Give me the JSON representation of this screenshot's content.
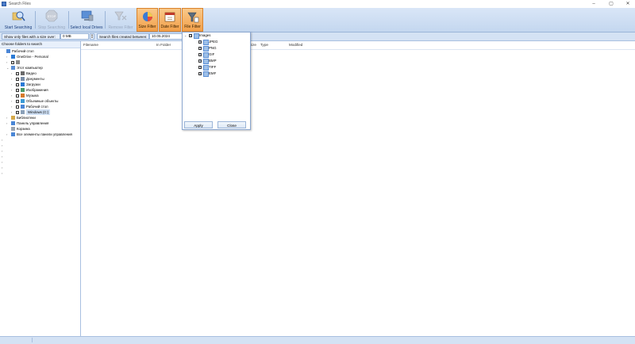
{
  "window": {
    "title": "Search Files",
    "controls": {
      "minimize": "–",
      "maximize": "▢",
      "close": "✕"
    }
  },
  "toolbar": {
    "buttons": [
      {
        "label": "Start Searching",
        "icon": "search-start-icon",
        "state": "enabled"
      },
      {
        "label": "Stop Searching",
        "icon": "stop-icon",
        "state": "disabled"
      },
      {
        "label": "Select local Drives",
        "icon": "drives-icon",
        "state": "enabled"
      },
      {
        "label": "Remove Filter",
        "icon": "remove-filter-icon",
        "state": "disabled"
      },
      {
        "label": "Size Filter",
        "icon": "size-filter-icon",
        "state": "active"
      },
      {
        "label": "Date Filter",
        "icon": "date-filter-icon",
        "state": "active"
      },
      {
        "label": "File Filter",
        "icon": "file-filter-icon",
        "state": "active"
      }
    ]
  },
  "filterbar": {
    "size_label": "Show only files with a size over:",
    "size_value": "0 MB",
    "date_label": "Search files created between:",
    "date_value": "10.05.2024"
  },
  "leftpane": {
    "header": "Choose folders to search",
    "tree": [
      {
        "label": "Рабочий стол",
        "level": 0,
        "icon": "desktop-icon",
        "expander": "",
        "checkbox": false
      },
      {
        "label": "OneDrive - Personal",
        "level": 1,
        "icon": "cloud-icon",
        "expander": "›",
        "checkbox": false
      },
      {
        "label": "",
        "level": 1,
        "icon": "user-icon",
        "expander": "›",
        "checkbox": true
      },
      {
        "label": "Этот компьютер",
        "level": 1,
        "icon": "computer-icon",
        "expander": "⌄",
        "checkbox": false
      },
      {
        "label": "Видео",
        "level": 2,
        "icon": "video-folder-icon",
        "expander": "›",
        "checkbox": true
      },
      {
        "label": "Документы",
        "level": 2,
        "icon": "documents-folder-icon",
        "expander": "›",
        "checkbox": true
      },
      {
        "label": "Загрузки",
        "level": 2,
        "icon": "downloads-folder-icon",
        "expander": "›",
        "checkbox": true
      },
      {
        "label": "Изображения",
        "level": 2,
        "icon": "pictures-folder-icon",
        "expander": "›",
        "checkbox": true
      },
      {
        "label": "Музыка",
        "level": 2,
        "icon": "music-folder-icon",
        "expander": "›",
        "checkbox": true
      },
      {
        "label": "Объемные объекты",
        "level": 2,
        "icon": "3d-objects-folder-icon",
        "expander": "›",
        "checkbox": true
      },
      {
        "label": "Рабочий стол",
        "level": 2,
        "icon": "desktop-folder-icon",
        "expander": "›",
        "checkbox": true
      },
      {
        "label": "Windows (C:)",
        "level": 2,
        "icon": "drive-icon",
        "expander": "›",
        "checkbox": true
      },
      {
        "label": "Библиотеки",
        "level": 1,
        "icon": "libraries-icon",
        "expander": "›",
        "checkbox": false
      },
      {
        "label": "Панель управления",
        "level": 1,
        "icon": "control-panel-icon",
        "expander": "›",
        "checkbox": false
      },
      {
        "label": "Корзина",
        "level": 1,
        "icon": "recycle-bin-icon",
        "expander": "",
        "checkbox": false
      },
      {
        "label": "Все элементы панели управления",
        "level": 1,
        "icon": "control-panel-icon",
        "expander": "›",
        "checkbox": false
      },
      {
        "label": "",
        "level": 0,
        "icon": "",
        "expander": "›",
        "checkbox": false
      },
      {
        "label": "",
        "level": 0,
        "icon": "",
        "expander": "›",
        "checkbox": false
      },
      {
        "label": "",
        "level": 0,
        "icon": "",
        "expander": "›",
        "checkbox": false
      },
      {
        "label": "",
        "level": 0,
        "icon": "",
        "expander": "›",
        "checkbox": false
      },
      {
        "label": "",
        "level": 0,
        "icon": "",
        "expander": "›",
        "checkbox": false
      },
      {
        "label": "",
        "level": 0,
        "icon": "",
        "expander": "›",
        "checkbox": false
      },
      {
        "label": "",
        "level": 0,
        "icon": "",
        "expander": "›",
        "checkbox": false
      }
    ]
  },
  "results": {
    "columns": [
      "Filename",
      "In Folder",
      "Size",
      "Type",
      "Modified"
    ]
  },
  "file_filter_popup": {
    "root": {
      "label": "Images",
      "checked": true
    },
    "items": [
      {
        "label": "JPEG",
        "checked": true
      },
      {
        "label": "PNG",
        "checked": true
      },
      {
        "label": "GIF",
        "checked": true
      },
      {
        "label": "BMP",
        "checked": true
      },
      {
        "label": "TIFF",
        "checked": true
      },
      {
        "label": "EMF",
        "checked": true
      }
    ],
    "apply_label": "Apply",
    "close_label": "Close"
  },
  "colors": {
    "toolbar": "#c4d7ef",
    "active_button": "#f2a04a",
    "border": "#9bb5d8"
  }
}
